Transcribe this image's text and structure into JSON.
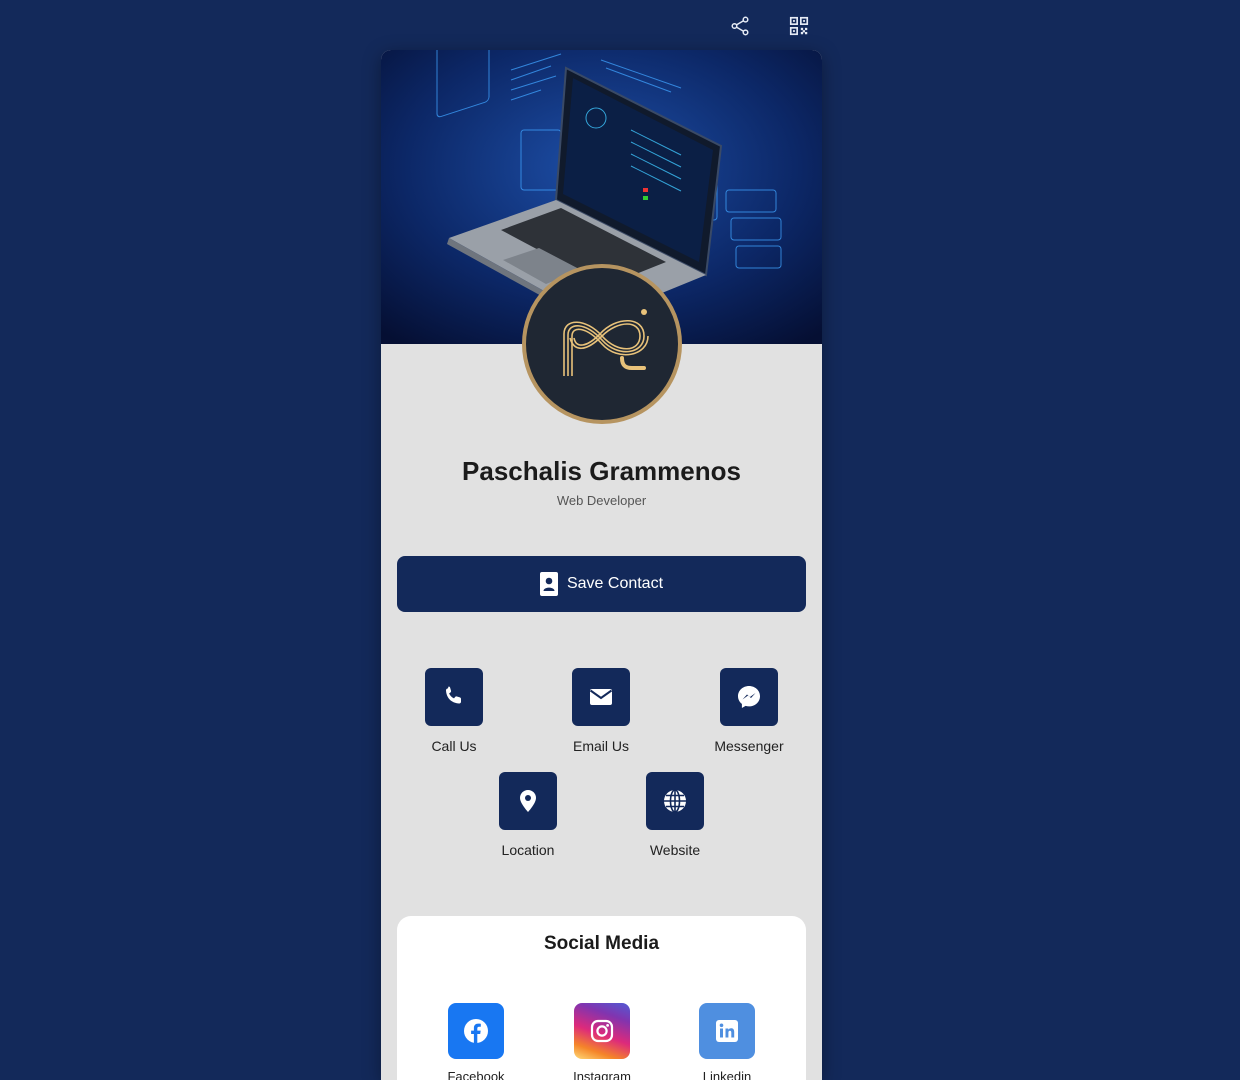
{
  "topbar": {
    "share_icon": "share-icon",
    "qr_icon": "qr-code-icon"
  },
  "profile": {
    "name": "Paschalis Grammenos",
    "role": "Web Developer"
  },
  "save_contact": {
    "label": "Save Contact",
    "icon": "contact-card-icon"
  },
  "actions": [
    {
      "label": "Call Us",
      "icon": "phone-icon"
    },
    {
      "label": "Email Us",
      "icon": "envelope-icon"
    },
    {
      "label": "Messenger",
      "icon": "messenger-icon"
    },
    {
      "label": "Location",
      "icon": "map-pin-icon"
    },
    {
      "label": "Website",
      "icon": "globe-icon"
    }
  ],
  "social": {
    "title": "Social Media",
    "items": [
      {
        "label": "Facebook",
        "icon": "facebook-icon",
        "color": "#1877f2"
      },
      {
        "label": "Instagram",
        "icon": "instagram-icon",
        "color": "#dd2a7b"
      },
      {
        "label": "Linkedin",
        "icon": "linkedin-icon",
        "color": "#4f8fe0"
      }
    ]
  },
  "colors": {
    "background": "#13295a",
    "card": "#e1e1e1",
    "accent": "#13295a",
    "avatar_ring": "#b69460"
  }
}
